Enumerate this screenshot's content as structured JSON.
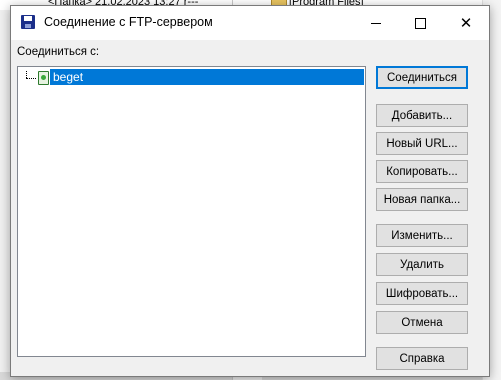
{
  "background": {
    "left_panel_text": "<Папка>  21.02.2023 13:27  r---",
    "right_panel_text": "[Program Files]"
  },
  "dialog": {
    "title": "Соединение с FTP-сервером",
    "window_controls": {
      "minimize": "—",
      "maximize": "☐",
      "close": "✕"
    },
    "connect_label": "Соединиться с:",
    "tree": {
      "items": [
        {
          "label": "beget",
          "selected": true,
          "icon": "ftp-server-icon"
        }
      ]
    },
    "buttons": {
      "connect": "Соединиться",
      "add": "Добавить...",
      "new_url": "Новый URL...",
      "copy": "Копировать...",
      "new_folder": "Новая папка...",
      "edit": "Изменить...",
      "delete": "Удалить",
      "encrypt": "Шифровать...",
      "cancel": "Отмена",
      "help": "Справка"
    }
  },
  "colors": {
    "selection": "#0078d7",
    "dialog_bg": "#f0f0f0",
    "button_bg": "#e1e1e1",
    "button_border": "#adadad",
    "default_button_border": "#0078d7"
  }
}
